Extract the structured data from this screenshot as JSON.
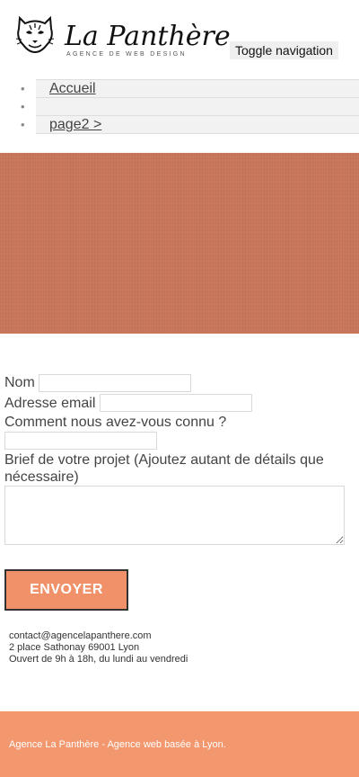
{
  "header": {
    "brand": "La Panthère",
    "tagline": "AGENCE DE WEB DESIGN",
    "toggle_label": "Toggle navigation",
    "logo_icon": "panther-head-icon"
  },
  "nav": {
    "items": [
      {
        "label": "Accueil"
      },
      {
        "label": ""
      },
      {
        "label": "page2 >"
      }
    ]
  },
  "hero": {
    "color": "#c8775a"
  },
  "form": {
    "name_label": "Nom",
    "email_label": "Adresse email",
    "source_label": "Comment nous avez-vous connu ?",
    "brief_label_line1": "Brief de votre projet (Ajoutez autant de détails que",
    "brief_label_line2": "nécessaire)",
    "submit_label": "ENVOYER",
    "name_value": "",
    "email_value": "",
    "source_value": "",
    "brief_value": ""
  },
  "contact": {
    "email": "contact@agencelapanthere.com",
    "address": "2 place Sathonay 69001 Lyon",
    "hours": "Ouvert de 9h à 18h, du lundi au vendredi"
  },
  "footer": {
    "text": "Agence La Panthère - Agence web basée à Lyon.",
    "color": "#f2976e"
  },
  "colors": {
    "accent": "#f0916a"
  }
}
